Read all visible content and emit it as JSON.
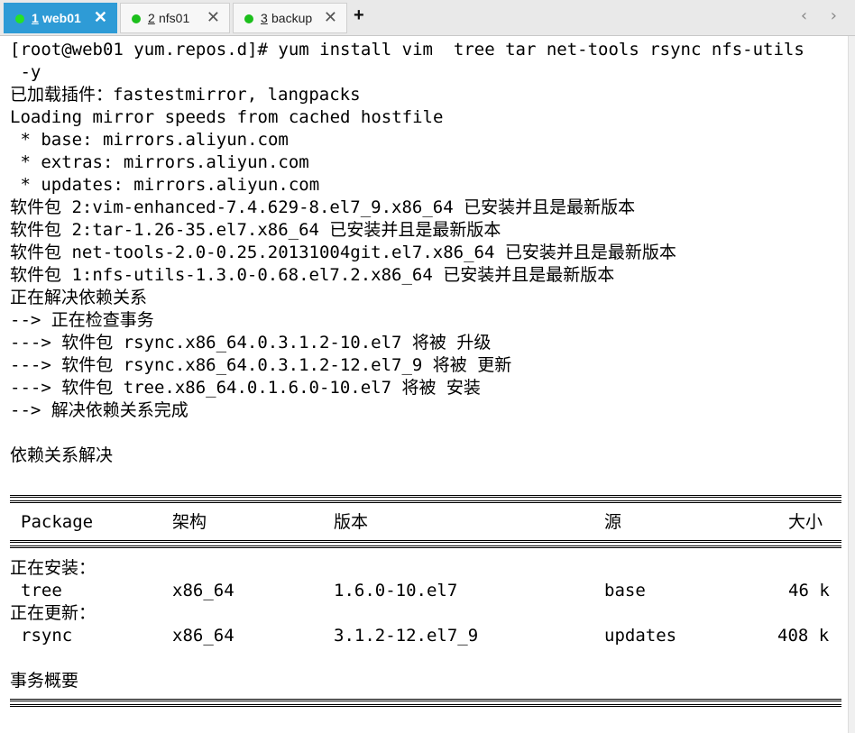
{
  "tabs": [
    {
      "num": "1",
      "name": "web01",
      "active": true
    },
    {
      "num": "2",
      "name": "nfs01",
      "active": false
    },
    {
      "num": "3",
      "name": "backup",
      "active": false
    }
  ],
  "tab_close": "✕",
  "new_tab": "+",
  "nav_arrows": "‹ ›",
  "terminal": {
    "lines": [
      "[root@web01 yum.repos.d]# yum install vim  tree tar net-tools rsync nfs-utils",
      " -y",
      "已加载插件：fastestmirror, langpacks",
      "Loading mirror speeds from cached hostfile",
      " * base: mirrors.aliyun.com",
      " * extras: mirrors.aliyun.com",
      " * updates: mirrors.aliyun.com",
      "软件包 2:vim-enhanced-7.4.629-8.el7_9.x86_64 已安装并且是最新版本",
      "软件包 2:tar-1.26-35.el7.x86_64 已安装并且是最新版本",
      "软件包 net-tools-2.0-0.25.20131004git.el7.x86_64 已安装并且是最新版本",
      "软件包 1:nfs-utils-1.3.0-0.68.el7.2.x86_64 已安装并且是最新版本",
      "正在解决依赖关系",
      "--> 正在检查事务",
      "---> 软件包 rsync.x86_64.0.3.1.2-10.el7 将被 升级",
      "---> 软件包 rsync.x86_64.0.3.1.2-12.el7_9 将被 更新",
      "---> 软件包 tree.x86_64.0.1.6.0-10.el7 将被 安装",
      "--> 解决依赖关系完成",
      "",
      "依赖关系解决"
    ],
    "table": {
      "headers": {
        "package": "Package",
        "arch": "架构",
        "version": "版本",
        "repo": "源",
        "size": "大小"
      },
      "installing_label": "正在安装：",
      "updating_label": "正在更新：",
      "rows": [
        {
          "package": "tree",
          "arch": "x86_64",
          "version": "1.6.0-10.el7",
          "repo": "base",
          "size": "46 k"
        },
        {
          "package": "rsync",
          "arch": "x86_64",
          "version": "3.1.2-12.el7_9",
          "repo": "updates",
          "size": "408 k"
        }
      ],
      "summary_label": "事务概要"
    }
  }
}
